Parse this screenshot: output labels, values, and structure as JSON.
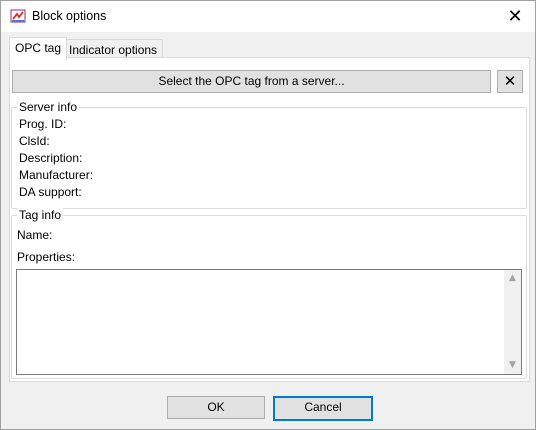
{
  "window": {
    "title": "Block options"
  },
  "tabs": [
    {
      "label": "OPC tag",
      "active": true
    },
    {
      "label": "Indicator options",
      "active": false
    }
  ],
  "select_button": {
    "label": "Select the OPC tag from a server..."
  },
  "clear_button": {
    "label": "✕"
  },
  "server_info": {
    "legend": "Server info",
    "fields": [
      "Prog. ID:",
      "ClsId:",
      "Description:",
      "Manufacturer:",
      "DA support:"
    ]
  },
  "tag_info": {
    "legend": "Tag info",
    "name_label": "Name:",
    "properties_label": "Properties:"
  },
  "buttons": {
    "ok": "OK",
    "cancel": "Cancel"
  },
  "colors": {
    "accent": "#0078d7",
    "panel": "#ffffff",
    "background": "#f0f0f0"
  }
}
